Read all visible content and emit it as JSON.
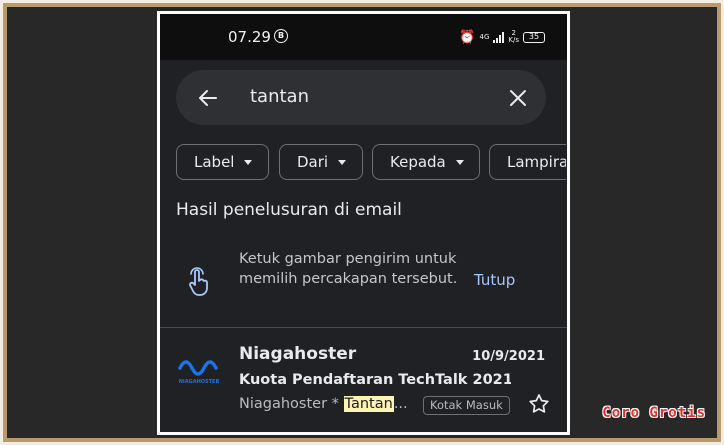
{
  "status_bar": {
    "time": "07.29",
    "b_badge": "B",
    "alarm_icon": "alarm-clock-icon",
    "network_small": "4G",
    "speed_top": "2",
    "speed_unit": "K/s",
    "battery": "35"
  },
  "search": {
    "query": "tantan",
    "back_icon": "arrow-left-icon",
    "clear_icon": "close-icon"
  },
  "filters": [
    {
      "label": "Label"
    },
    {
      "label": "Dari"
    },
    {
      "label": "Kepada"
    },
    {
      "label": "Lampiran"
    }
  ],
  "section_title": "Hasil penelusuran di email",
  "tip": {
    "text": "Ketuk gambar pengirim untuk memilih percakapan tersebut.",
    "dismiss_label": "Tutup",
    "icon": "tap-hand-icon"
  },
  "emails": [
    {
      "sender": "Niagahoster",
      "logo_text": "NIAGAHOSTER",
      "date": "10/9/2021",
      "subject": "Kuota Pendaftaran TechTalk 2021...",
      "snippet_prefix": "Niagahoster * ",
      "snippet_match": "Tantan",
      "snippet_suffix": "...",
      "label": "Kotak Masuk"
    }
  ],
  "watermark": "Coro Grotis",
  "colors": {
    "background": "#202124",
    "accent_link": "#a8c7fa",
    "highlight": "#fdf3b2",
    "logo_blue": "#1a73e8"
  }
}
